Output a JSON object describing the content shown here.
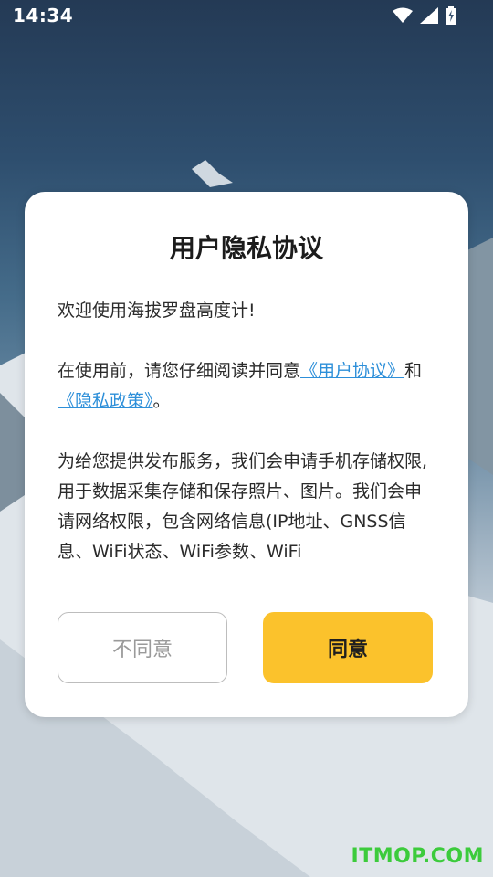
{
  "status_bar": {
    "time": "14:34",
    "icons": [
      "wifi-icon",
      "signal-icon",
      "battery-charging-icon"
    ]
  },
  "dialog": {
    "title": "用户隐私协议",
    "welcome": "欢迎使用海拔罗盘高度计!",
    "consent_prefix": "在使用前，请您仔细阅读并同意",
    "user_agreement_link": "《用户协议》",
    "consent_and": "和",
    "privacy_policy_link": "《隐私政策》",
    "consent_suffix": "。",
    "permissions_text": "为给您提供发布服务，我们会申请手机存储权限, 用于数据采集存储和保存照片、图片。我们会申请网络权限，包含网络信息(IP地址、GNSS信息、WiFi状态、WiFi参数、WiFi",
    "disagree_label": "不同意",
    "agree_label": "同意"
  },
  "watermark": "ITMOP.COM",
  "colors": {
    "agree_button": "#fbc22c",
    "link": "#2d8fd9",
    "watermark": "#3ccb3c"
  }
}
